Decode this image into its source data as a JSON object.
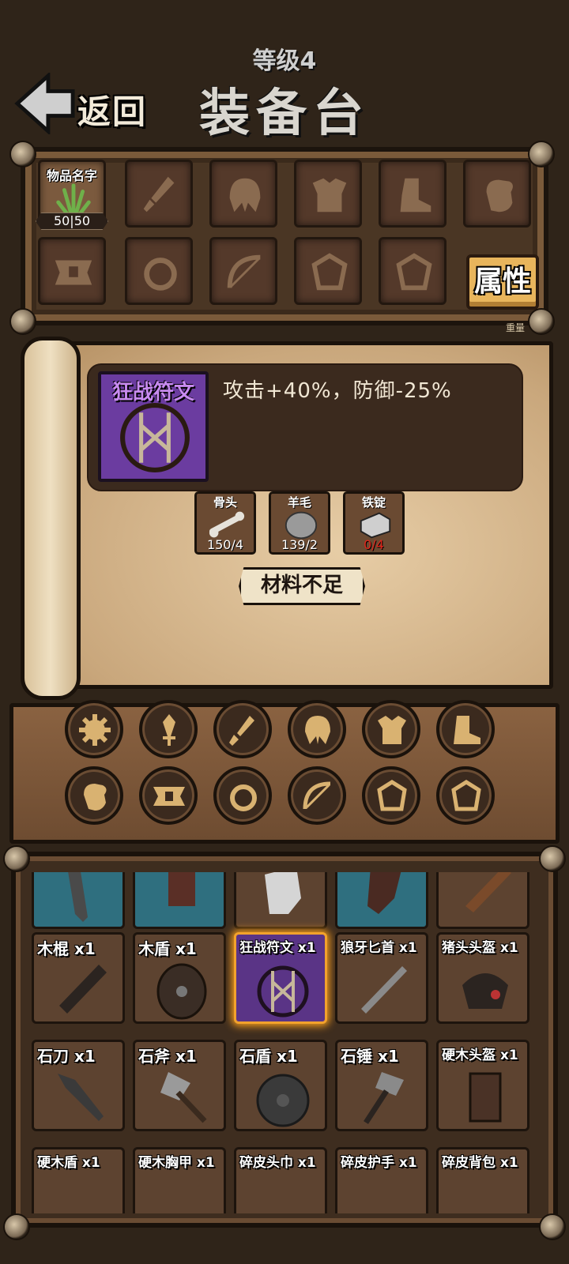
{
  "header": {
    "back_label": "返回",
    "level": "等级4",
    "title": "装备台"
  },
  "equip_slots": {
    "selected_item": {
      "name": "物品名字",
      "count": "50|50",
      "icon": "grass-icon"
    },
    "slot_icons": [
      "sword-icon",
      "helmet-icon",
      "armor-icon",
      "boots-icon",
      "glove-icon",
      "belt-icon",
      "ring-icon",
      "bow-icon",
      "rune-icon",
      "rune-icon"
    ],
    "attributes_button": "属性",
    "weight_label": "重量"
  },
  "detail": {
    "item_name": "狂战符文",
    "effect": "攻击+40%，防御-25%",
    "materials": [
      {
        "name": "骨头",
        "count": "150/4",
        "enough": true
      },
      {
        "name": "羊毛",
        "count": "139/2",
        "enough": true
      },
      {
        "name": "铁锭",
        "count": "0/4",
        "enough": false
      }
    ],
    "craft_button": "材料不足"
  },
  "categories": [
    "gear-icon",
    "dagger-icon",
    "sword-icon",
    "helmet-icon",
    "armor-icon",
    "boots-icon",
    "glove-icon",
    "belt-icon",
    "ring-icon",
    "bow-icon",
    "rune-icon",
    "rune-icon"
  ],
  "inventory": {
    "row1": [
      {
        "name": "",
        "icon": "leg-armor-icon"
      },
      {
        "name": "",
        "icon": "bracer-icon"
      },
      {
        "name": "",
        "icon": "glove-icon"
      },
      {
        "name": "",
        "icon": "gauntlet-icon"
      },
      {
        "name": "",
        "icon": "club-icon"
      }
    ],
    "row2": [
      {
        "name": "木棍 x1",
        "icon": "club-icon"
      },
      {
        "name": "木盾 x1",
        "icon": "shield-icon"
      },
      {
        "name": "狂战符文 x1",
        "icon": "rune-icon"
      },
      {
        "name": "狼牙匕首 x1",
        "icon": "dagger-icon"
      },
      {
        "name": "猪头头盔 x1",
        "icon": "boar-helmet-icon"
      }
    ],
    "row3": [
      {
        "name": "石刀 x1",
        "icon": "knife-icon"
      },
      {
        "name": "石斧 x1",
        "icon": "axe-icon"
      },
      {
        "name": "石盾 x1",
        "icon": "round-shield-icon"
      },
      {
        "name": "石锤 x1",
        "icon": "hammer-icon"
      },
      {
        "name": "硬木头盔 x1",
        "icon": "helmet-icon"
      }
    ],
    "row4": [
      {
        "name": "硬木盾 x1",
        "icon": "shield-icon"
      },
      {
        "name": "硬木胸甲 x1",
        "icon": "armor-icon"
      },
      {
        "name": "碎皮头巾 x1",
        "icon": "hood-icon"
      },
      {
        "name": "碎皮护手 x1",
        "icon": "glove-icon"
      },
      {
        "name": "碎皮背包 x1",
        "icon": "bag-icon"
      }
    ]
  },
  "colors": {
    "accent": "#e8b55c",
    "selected_glow": "#f29a1c",
    "rune_purple": "#6b3ca0",
    "insufficient": "#e0261b"
  }
}
